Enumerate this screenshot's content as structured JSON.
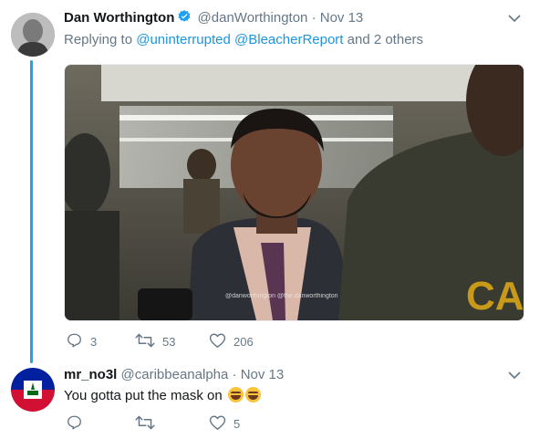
{
  "tweet1": {
    "name": "Dan Worthington",
    "handle": "@danWorthington",
    "separator": "·",
    "time": "Nov 13",
    "reply_prefix": "Replying to",
    "reply_mention1": "@uninterrupted",
    "reply_mention2": "@BleacherReport",
    "reply_suffix": "and 2 others",
    "media_watermark": "@danworthington @the.danworthington",
    "media_shirt_text": "CA",
    "replies": "3",
    "retweets": "53",
    "likes": "206"
  },
  "tweet2": {
    "name": "mr_no3l",
    "handle": "@caribbeanalpha",
    "separator": "·",
    "time": "Nov 13",
    "text": "You gotta put the mask on",
    "emojis": "😂😂",
    "replies": "",
    "retweets": "",
    "likes": "5"
  },
  "colors": {
    "accent": "#1da1f2",
    "link": "#1b95e0",
    "muted": "#657786",
    "text": "#14171a"
  },
  "icons": [
    "reply-icon",
    "retweet-icon",
    "like-icon",
    "chevron-down-icon",
    "verified-icon"
  ]
}
